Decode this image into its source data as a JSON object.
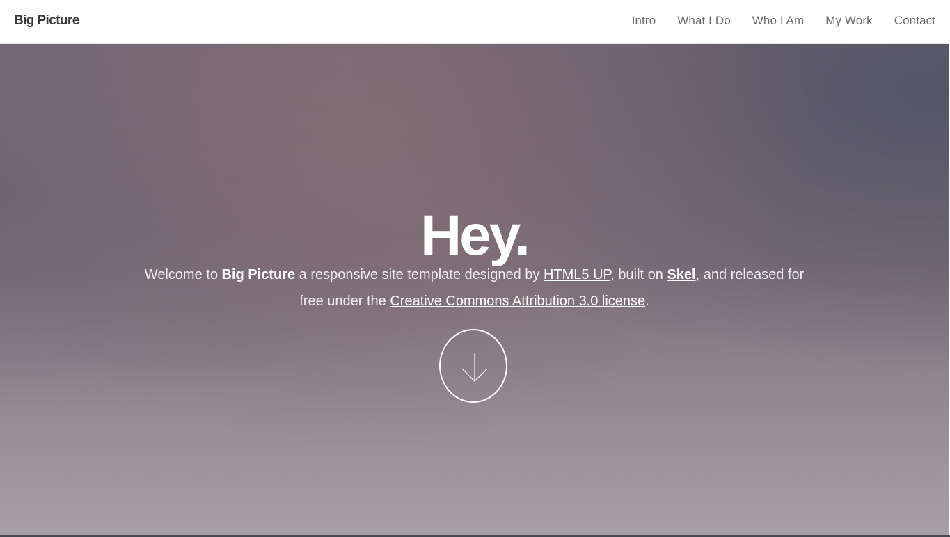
{
  "header": {
    "logo": "Big Picture",
    "nav": [
      {
        "label": "Intro"
      },
      {
        "label": "What I Do"
      },
      {
        "label": "Who I Am"
      },
      {
        "label": "My Work"
      },
      {
        "label": "Contact"
      }
    ]
  },
  "hero": {
    "title": "Hey.",
    "intro": {
      "t1": "Welcome to ",
      "brand": "Big Picture",
      "t2": " a responsive site template designed by ",
      "link_html5up": "HTML5 UP",
      "t3": ", built on ",
      "link_skel": "Skel",
      "t4": ", and released for free under the ",
      "link_license": "Creative Commons Attribution 3.0 license",
      "t5": "."
    },
    "scroll_icon": "arrow-down-icon"
  }
}
